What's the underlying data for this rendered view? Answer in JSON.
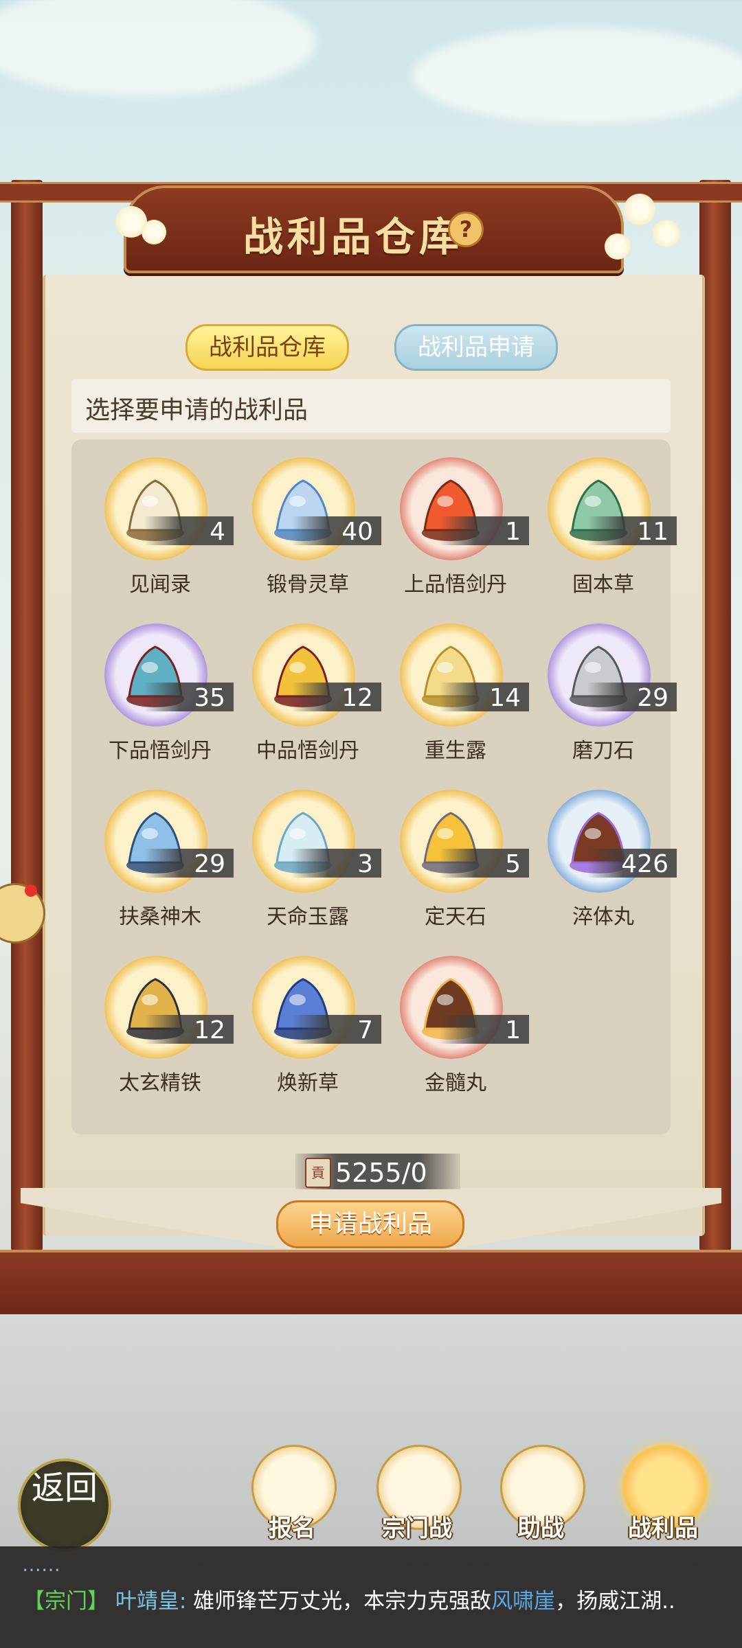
{
  "header": {
    "title": "战利品仓库",
    "help_label": "?"
  },
  "tabs": [
    {
      "label": "战利品仓库",
      "active": true
    },
    {
      "label": "战利品申请",
      "active": false
    }
  ],
  "hint": "选择要申请的战利品",
  "items": [
    {
      "name": "见闻录",
      "count": "4",
      "frame": "gold",
      "icon": "scroll-book-icon"
    },
    {
      "name": "锻骨灵草",
      "count": "40",
      "frame": "gold",
      "icon": "blue-flower-icon"
    },
    {
      "name": "上品悟剑丹",
      "count": "1",
      "frame": "red",
      "icon": "red-pill-icon"
    },
    {
      "name": "固本草",
      "count": "11",
      "frame": "gold",
      "icon": "green-herb-icon"
    },
    {
      "name": "下品悟剑丹",
      "count": "35",
      "frame": "purple",
      "icon": "teal-pill-icon"
    },
    {
      "name": "中品悟剑丹",
      "count": "12",
      "frame": "gold",
      "icon": "yellow-pill-icon"
    },
    {
      "name": "重生露",
      "count": "14",
      "frame": "gold",
      "icon": "gourd-bottle-icon"
    },
    {
      "name": "磨刀石",
      "count": "29",
      "frame": "purple",
      "icon": "whetstone-icon"
    },
    {
      "name": "扶桑神木",
      "count": "29",
      "frame": "gold",
      "icon": "wood-log-icon"
    },
    {
      "name": "天命玉露",
      "count": "3",
      "frame": "gold",
      "icon": "jade-vase-icon"
    },
    {
      "name": "定天石",
      "count": "5",
      "frame": "gold",
      "icon": "fire-stone-icon"
    },
    {
      "name": "淬体丸",
      "count": "426",
      "frame": "blue",
      "icon": "treasure-chest-icon"
    },
    {
      "name": "太玄精铁",
      "count": "12",
      "frame": "gold",
      "icon": "gold-ore-icon"
    },
    {
      "name": "焕新草",
      "count": "7",
      "frame": "gold",
      "icon": "blue-lotus-icon"
    },
    {
      "name": "金髓丸",
      "count": "1",
      "frame": "red",
      "icon": "chest-orb-icon"
    }
  ],
  "currency": {
    "icon_char": "貢",
    "value": "5255/0"
  },
  "apply_button": "申请战利品",
  "nav": {
    "back": "返回",
    "buttons": [
      {
        "label": "报名",
        "icon": "scroll-brush-icon",
        "active": false
      },
      {
        "label": "宗门战",
        "icon": "mountain-flag-icon",
        "active": false
      },
      {
        "label": "助战",
        "icon": "handshake-icon",
        "active": false
      },
      {
        "label": "战利品",
        "icon": "treasure-chest-icon",
        "active": true
      }
    ]
  },
  "chat": {
    "dots": "……",
    "channel": "【宗门】",
    "user": "叶靖皇:",
    "text_before": "雄师锋芒万丈光，本宗力克强敌",
    "place": "风啸崖",
    "text_after": "，扬威江湖.."
  },
  "colors": {
    "accent_gold": "#f6d552",
    "frame_red": "#8a3a20",
    "chat_channel": "#62d25a",
    "chat_user": "#7cc5e8"
  }
}
